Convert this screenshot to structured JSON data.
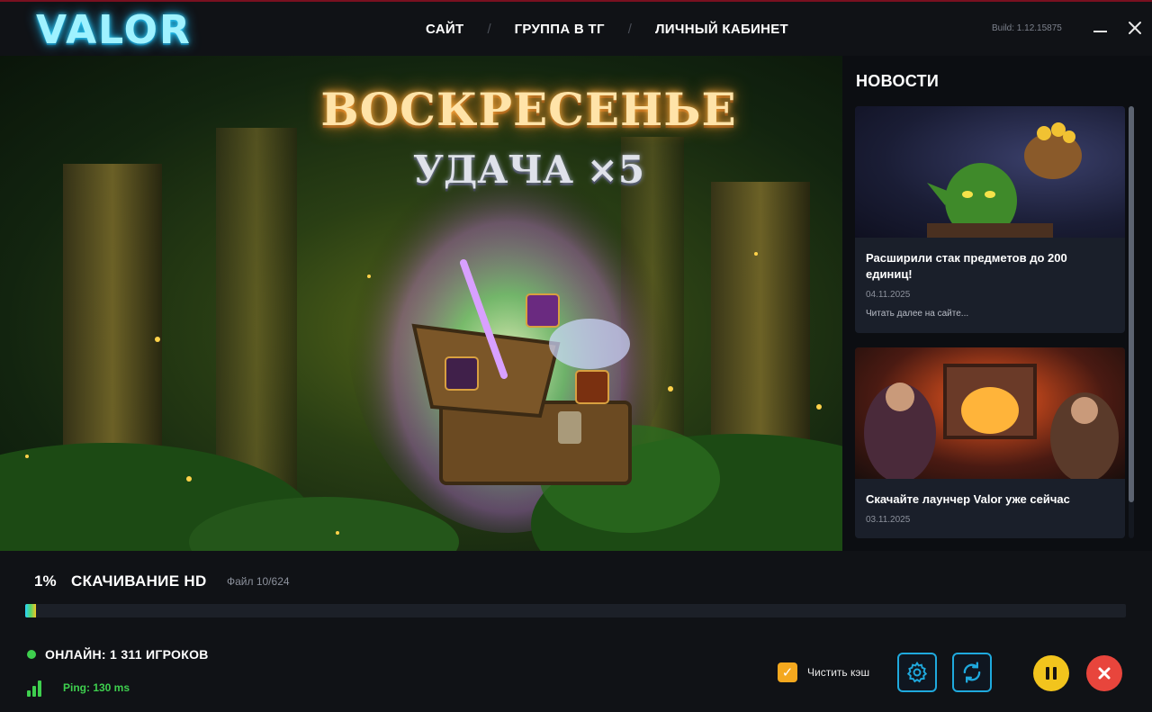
{
  "app": {
    "logo": "VALOR",
    "build": "Build: 1.12.15875"
  },
  "nav": {
    "site": "САЙТ",
    "tg_group": "ГРУППА В ТГ",
    "cabinet": "ЛИЧНЫЙ КАБИНЕТ",
    "separator": "/"
  },
  "window_controls": {
    "minimize_icon": "minimize-icon",
    "close_icon": "close-icon"
  },
  "banner": {
    "title": "ВОСКРЕСЕНЬЕ",
    "subtitle": "УДАЧА ×5"
  },
  "news": {
    "heading": "НОВОСТИ",
    "items": [
      {
        "title": "Расширили стак предметов до 200 единиц!",
        "date": "04.11.2025",
        "more": "Читать далее на сайте..."
      },
      {
        "title": "Скачайте лаунчер Valor уже сейчас",
        "date": "03.11.2025"
      }
    ]
  },
  "download": {
    "percent": "1%",
    "label": "СКАЧИВАНИЕ HD",
    "files": "Файл 10/624",
    "progress_fraction": 0.01
  },
  "status": {
    "online": "ОНЛАЙН: 1 311 ИГРОКОВ",
    "ping": "Ping: 130 ms"
  },
  "controls": {
    "clear_cache_label": "Чистить кэш",
    "clear_cache_checked": true
  },
  "colors": {
    "accent_blue": "#1fa9dd",
    "online_green": "#3ecf4e",
    "pause_yellow": "#f2c41d",
    "stop_red": "#e8453c",
    "checkbox_orange": "#f4a81e"
  }
}
